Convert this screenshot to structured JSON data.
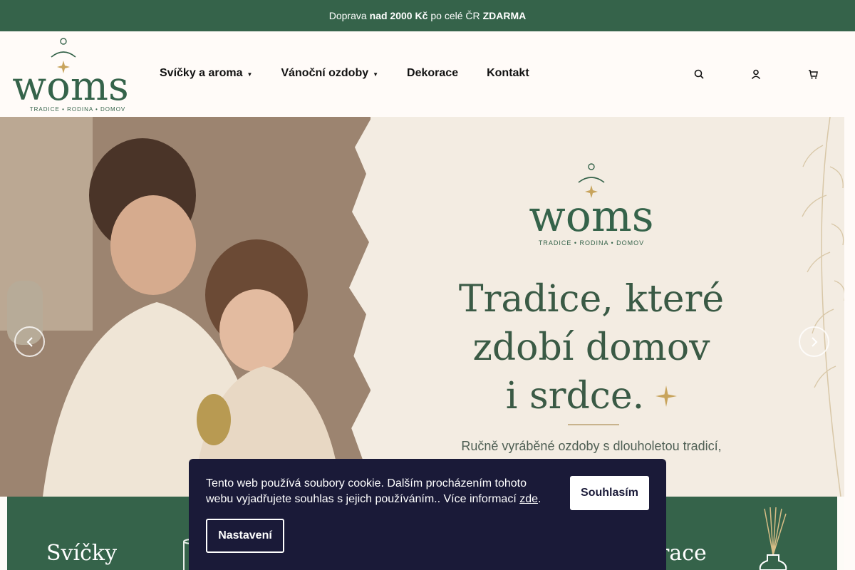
{
  "topbar": {
    "pre": "Doprava",
    "bold1": "nad 2000 Kč",
    "mid": "po celé ČR",
    "bold2": "ZDARMA"
  },
  "logo": {
    "text": "woms",
    "tagline": "TRADICE • RODINA • DOMOV"
  },
  "nav": [
    {
      "label": "Svíčky a aroma",
      "has_dropdown": true
    },
    {
      "label": "Vánoční ozdoby",
      "has_dropdown": true
    },
    {
      "label": "Dekorace",
      "has_dropdown": false
    },
    {
      "label": "Kontakt",
      "has_dropdown": false
    }
  ],
  "header_icons": [
    "search-icon",
    "user-icon",
    "cart-icon"
  ],
  "hero": {
    "logo_text": "woms",
    "logo_tagline": "TRADICE • RODINA • DOMOV",
    "title_line1": "Tradice, které",
    "title_line2": "zdobí domov",
    "title_line3": "i srdce.",
    "subtitle": "Ručně vyráběné ozdoby s dlouholetou tradicí,"
  },
  "tiles": {
    "tile1": "Svíčky",
    "tile2": "race"
  },
  "cookie": {
    "text": "Tento web používá soubory cookie. Dalším procházením tohoto webu vyjadřujete souhlas s jejich používáním.. Více informací",
    "link": "zde",
    "end": ".",
    "accept_label": "Souhlasím",
    "settings_label": "Nastavení"
  },
  "colors": {
    "brand_green": "#35634a",
    "cookie_bg": "#1a1a38",
    "accent_gold": "#c8a45c"
  }
}
